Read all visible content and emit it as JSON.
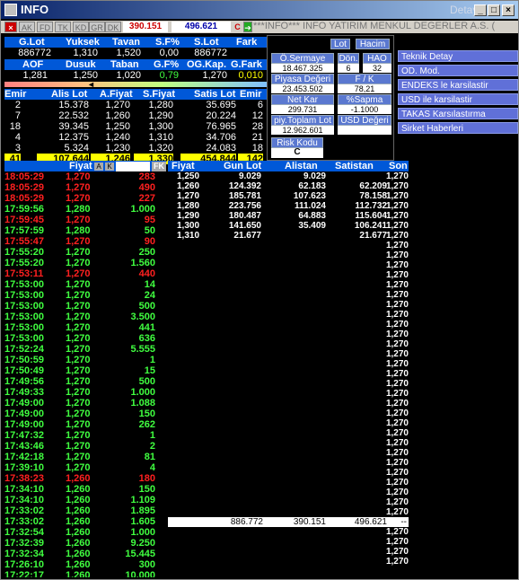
{
  "title": "INFO",
  "detay": "Detay",
  "wbtns": {
    "min": "_",
    "max": "□",
    "close": "×"
  },
  "tabs": [
    "AK",
    "FD",
    "TK",
    "KD",
    "GR",
    "DK"
  ],
  "toolbar": {
    "val1": "390.151",
    "val2": "496.621",
    "c": "C"
  },
  "marquee": "***INFO*** INFO YATIRIM MENKUL DEGERLER A.S. (",
  "summary1": {
    "h": [
      "G.Lot",
      "Yuksek",
      "Tavan",
      "S.F%",
      "S.Lot",
      "Fark"
    ],
    "v": [
      "886772",
      "1,310",
      "1,520",
      "0,00",
      "886772",
      ""
    ]
  },
  "summary2": {
    "h": [
      "AOF",
      "Dusuk",
      "Taban",
      "G.F%",
      "OG.Kap.",
      "G.Fark"
    ],
    "v": [
      "1,281",
      "1,250",
      "1,020",
      "0,79",
      "1,270",
      "0,010"
    ]
  },
  "depth": {
    "h": [
      "Emir",
      "Alis Lot",
      "A.Fiyat",
      "S.Fiyat",
      "Satis Lot",
      "Emir"
    ],
    "rows": [
      [
        "2",
        "15.378",
        "1,270",
        "1,280",
        "35.695",
        "6"
      ],
      [
        "7",
        "22.532",
        "1,260",
        "1,290",
        "20.224",
        "12"
      ],
      [
        "18",
        "39.345",
        "1,250",
        "1,300",
        "76.965",
        "28"
      ],
      [
        "4",
        "12.375",
        "1,240",
        "1,310",
        "34.706",
        "21"
      ],
      [
        "3",
        "5.324",
        "1,230",
        "1,320",
        "24.083",
        "18"
      ]
    ],
    "total": [
      "41",
      "107.644",
      "1,246",
      "1,330",
      "454.844",
      "142"
    ]
  },
  "panel": {
    "lot": "Lot",
    "hacim": "Hacim",
    "osermaye": "Ö.Sermaye",
    "osermaye_v": "18.467.325",
    "don": "Dön.",
    "don_v": "6",
    "hao": "HAO",
    "hao_v": "32",
    "piyasa": "Piyasa Değeri",
    "piyasa_v": "23.453.502",
    "fk": "F / K",
    "fk_v": "78,21",
    "netkar": "Net Kar",
    "netkar_v": "299.731",
    "sapma": "%Sapma",
    "sapma_v": "-1.1000",
    "piytop": "piy.Toplam Lot",
    "piytop_v": "12.962.601",
    "usd": "USD Değeri",
    "risk": "Risk Kodu",
    "risk_v": "C"
  },
  "side": [
    "Teknik Detay",
    "OD. Mod.",
    "ENDEKS le karsilastir",
    "USD ile karsilastir",
    "TAKAS Karsılastırma",
    "Sirket Haberleri"
  ],
  "thdr": {
    "fiyat": "Fiyat",
    "fk": "FK",
    "fiyat2": "Fiyat",
    "gunlot": "Gun Lot",
    "alistan": "Alistan",
    "satistan": "Satistan",
    "son": "Son"
  },
  "colors": {
    "red": "#ff2020",
    "green": "#40ff40",
    "yellow": "#ffff00"
  },
  "trades": [
    [
      "18:05:29",
      "1,270",
      "283",
      "r"
    ],
    [
      "18:05:29",
      "1,270",
      "490",
      "r"
    ],
    [
      "18:05:29",
      "1,270",
      "227",
      "r"
    ],
    [
      "17:59:56",
      "1,280",
      "1.000",
      "g"
    ],
    [
      "17:59:45",
      "1,270",
      "95",
      "r"
    ],
    [
      "17:57:59",
      "1,280",
      "50",
      "g"
    ],
    [
      "17:55:47",
      "1,270",
      "90",
      "r"
    ],
    [
      "17:55:20",
      "1,270",
      "250",
      "g"
    ],
    [
      "17:55:20",
      "1,270",
      "1.560",
      "g"
    ],
    [
      "17:53:11",
      "1,270",
      "440",
      "r"
    ],
    [
      "17:53:00",
      "1,270",
      "14",
      "g"
    ],
    [
      "17:53:00",
      "1,270",
      "24",
      "g"
    ],
    [
      "17:53:00",
      "1,270",
      "500",
      "g"
    ],
    [
      "17:53:00",
      "1,270",
      "3.500",
      "g"
    ],
    [
      "17:53:00",
      "1,270",
      "441",
      "g"
    ],
    [
      "17:53:00",
      "1,270",
      "636",
      "g"
    ],
    [
      "17:52:24",
      "1,270",
      "5.555",
      "g"
    ],
    [
      "17:50:59",
      "1,270",
      "1",
      "g"
    ],
    [
      "17:50:49",
      "1,270",
      "15",
      "g"
    ],
    [
      "17:49:56",
      "1,270",
      "500",
      "g"
    ],
    [
      "17:49:33",
      "1,270",
      "1.000",
      "g"
    ],
    [
      "17:49:00",
      "1,270",
      "1.088",
      "g"
    ],
    [
      "17:49:00",
      "1,270",
      "150",
      "g"
    ],
    [
      "17:49:00",
      "1,270",
      "262",
      "g"
    ],
    [
      "17:47:32",
      "1,270",
      "1",
      "g"
    ],
    [
      "17:43:46",
      "1,270",
      "2",
      "g"
    ],
    [
      "17:42:18",
      "1,270",
      "81",
      "g"
    ],
    [
      "17:39:10",
      "1,270",
      "4",
      "g"
    ],
    [
      "17:38:23",
      "1,260",
      "180",
      "r"
    ],
    [
      "17:34:10",
      "1,260",
      "150",
      "g"
    ],
    [
      "17:34:10",
      "1,260",
      "1.109",
      "g"
    ],
    [
      "17:33:02",
      "1,260",
      "1.895",
      "g"
    ],
    [
      "17:33:02",
      "1,260",
      "1.605",
      "g"
    ],
    [
      "17:32:54",
      "1,260",
      "1.000",
      "g"
    ],
    [
      "17:32:39",
      "1,260",
      "9.250",
      "g"
    ],
    [
      "17:32:34",
      "1,260",
      "15.445",
      "g"
    ],
    [
      "17:26:10",
      "1,260",
      "300",
      "g"
    ],
    [
      "17:22:17",
      "1,260",
      "10.000",
      "g"
    ]
  ],
  "book": [
    [
      "1,250",
      "9.029",
      "9.029",
      "",
      "1,270"
    ],
    [
      "1,260",
      "124.392",
      "62.183",
      "62.209",
      "1,270"
    ],
    [
      "1,270",
      "185.781",
      "107.623",
      "78.158",
      "1,270"
    ],
    [
      "1,280",
      "223.756",
      "111.024",
      "112.732",
      "1,270"
    ],
    [
      "1,290",
      "180.487",
      "64.883",
      "115.604",
      "1,270"
    ],
    [
      "1,300",
      "141.650",
      "35.409",
      "106.241",
      "1,270"
    ],
    [
      "1,310",
      "21.677",
      "",
      "21.677",
      "1,270"
    ]
  ],
  "son_rest": "1,270",
  "totals": {
    "gunlot": "886.772",
    "alistan": "390.151",
    "satistan": "496.621",
    "son": "--"
  }
}
